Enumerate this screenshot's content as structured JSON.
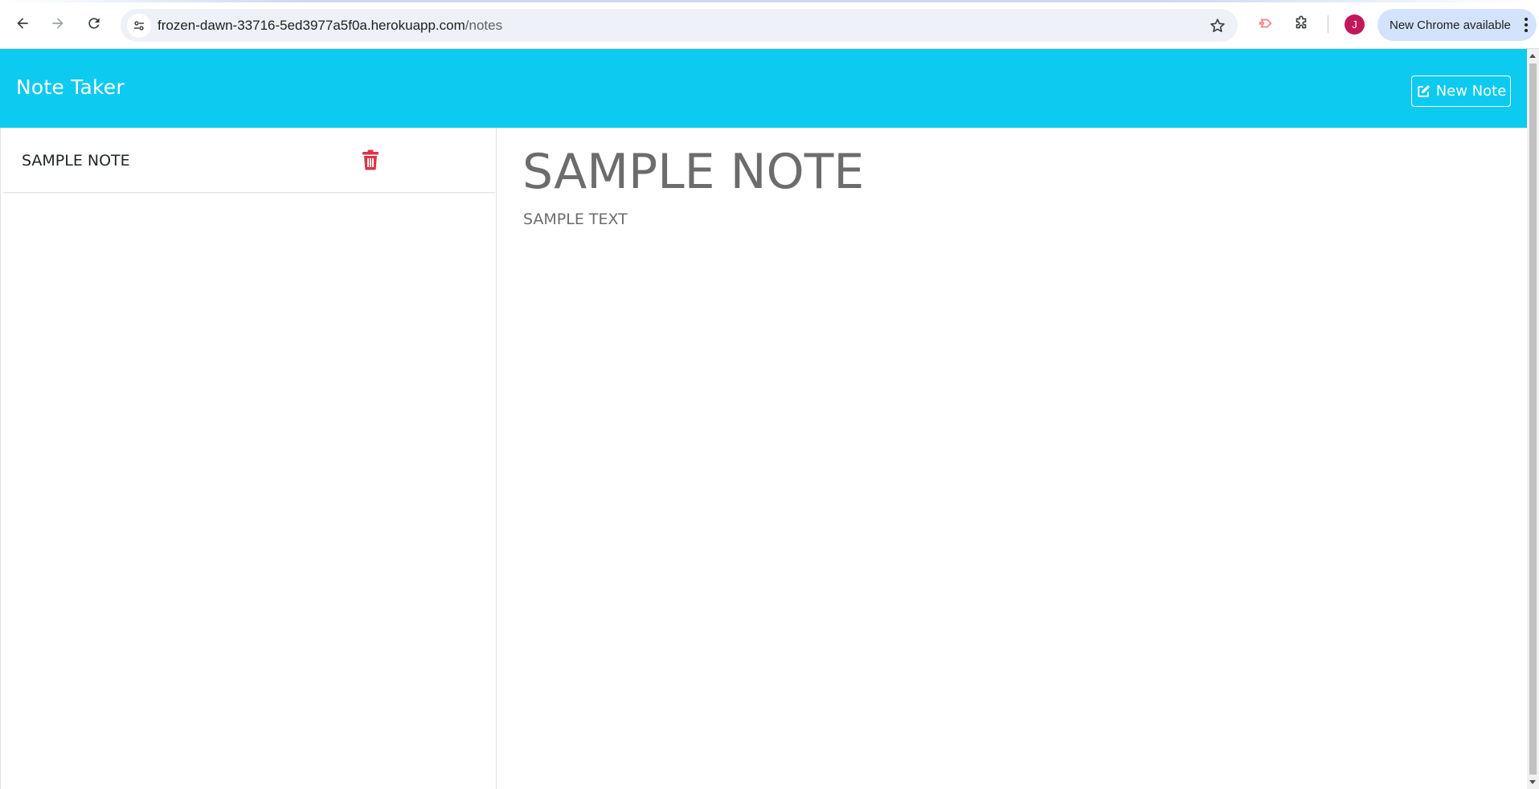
{
  "browser": {
    "url_host": "frozen-dawn-33716-5ed3977a5f0a.herokuapp.com",
    "url_path": "/notes",
    "profile_initial": "J",
    "update_label": "New Chrome available",
    "accent_color": "#c2185b"
  },
  "header": {
    "brand": "Note Taker",
    "new_note_label": "New Note",
    "background_color": "#0dcaf0"
  },
  "sidebar": {
    "notes": [
      {
        "title": "SAMPLE NOTE",
        "delete_icon": "trash-icon"
      }
    ]
  },
  "main": {
    "note_title": "SAMPLE NOTE",
    "note_text": "SAMPLE TEXT"
  },
  "colors": {
    "delete": "#dc3545",
    "text_muted": "#6c6c6c"
  }
}
